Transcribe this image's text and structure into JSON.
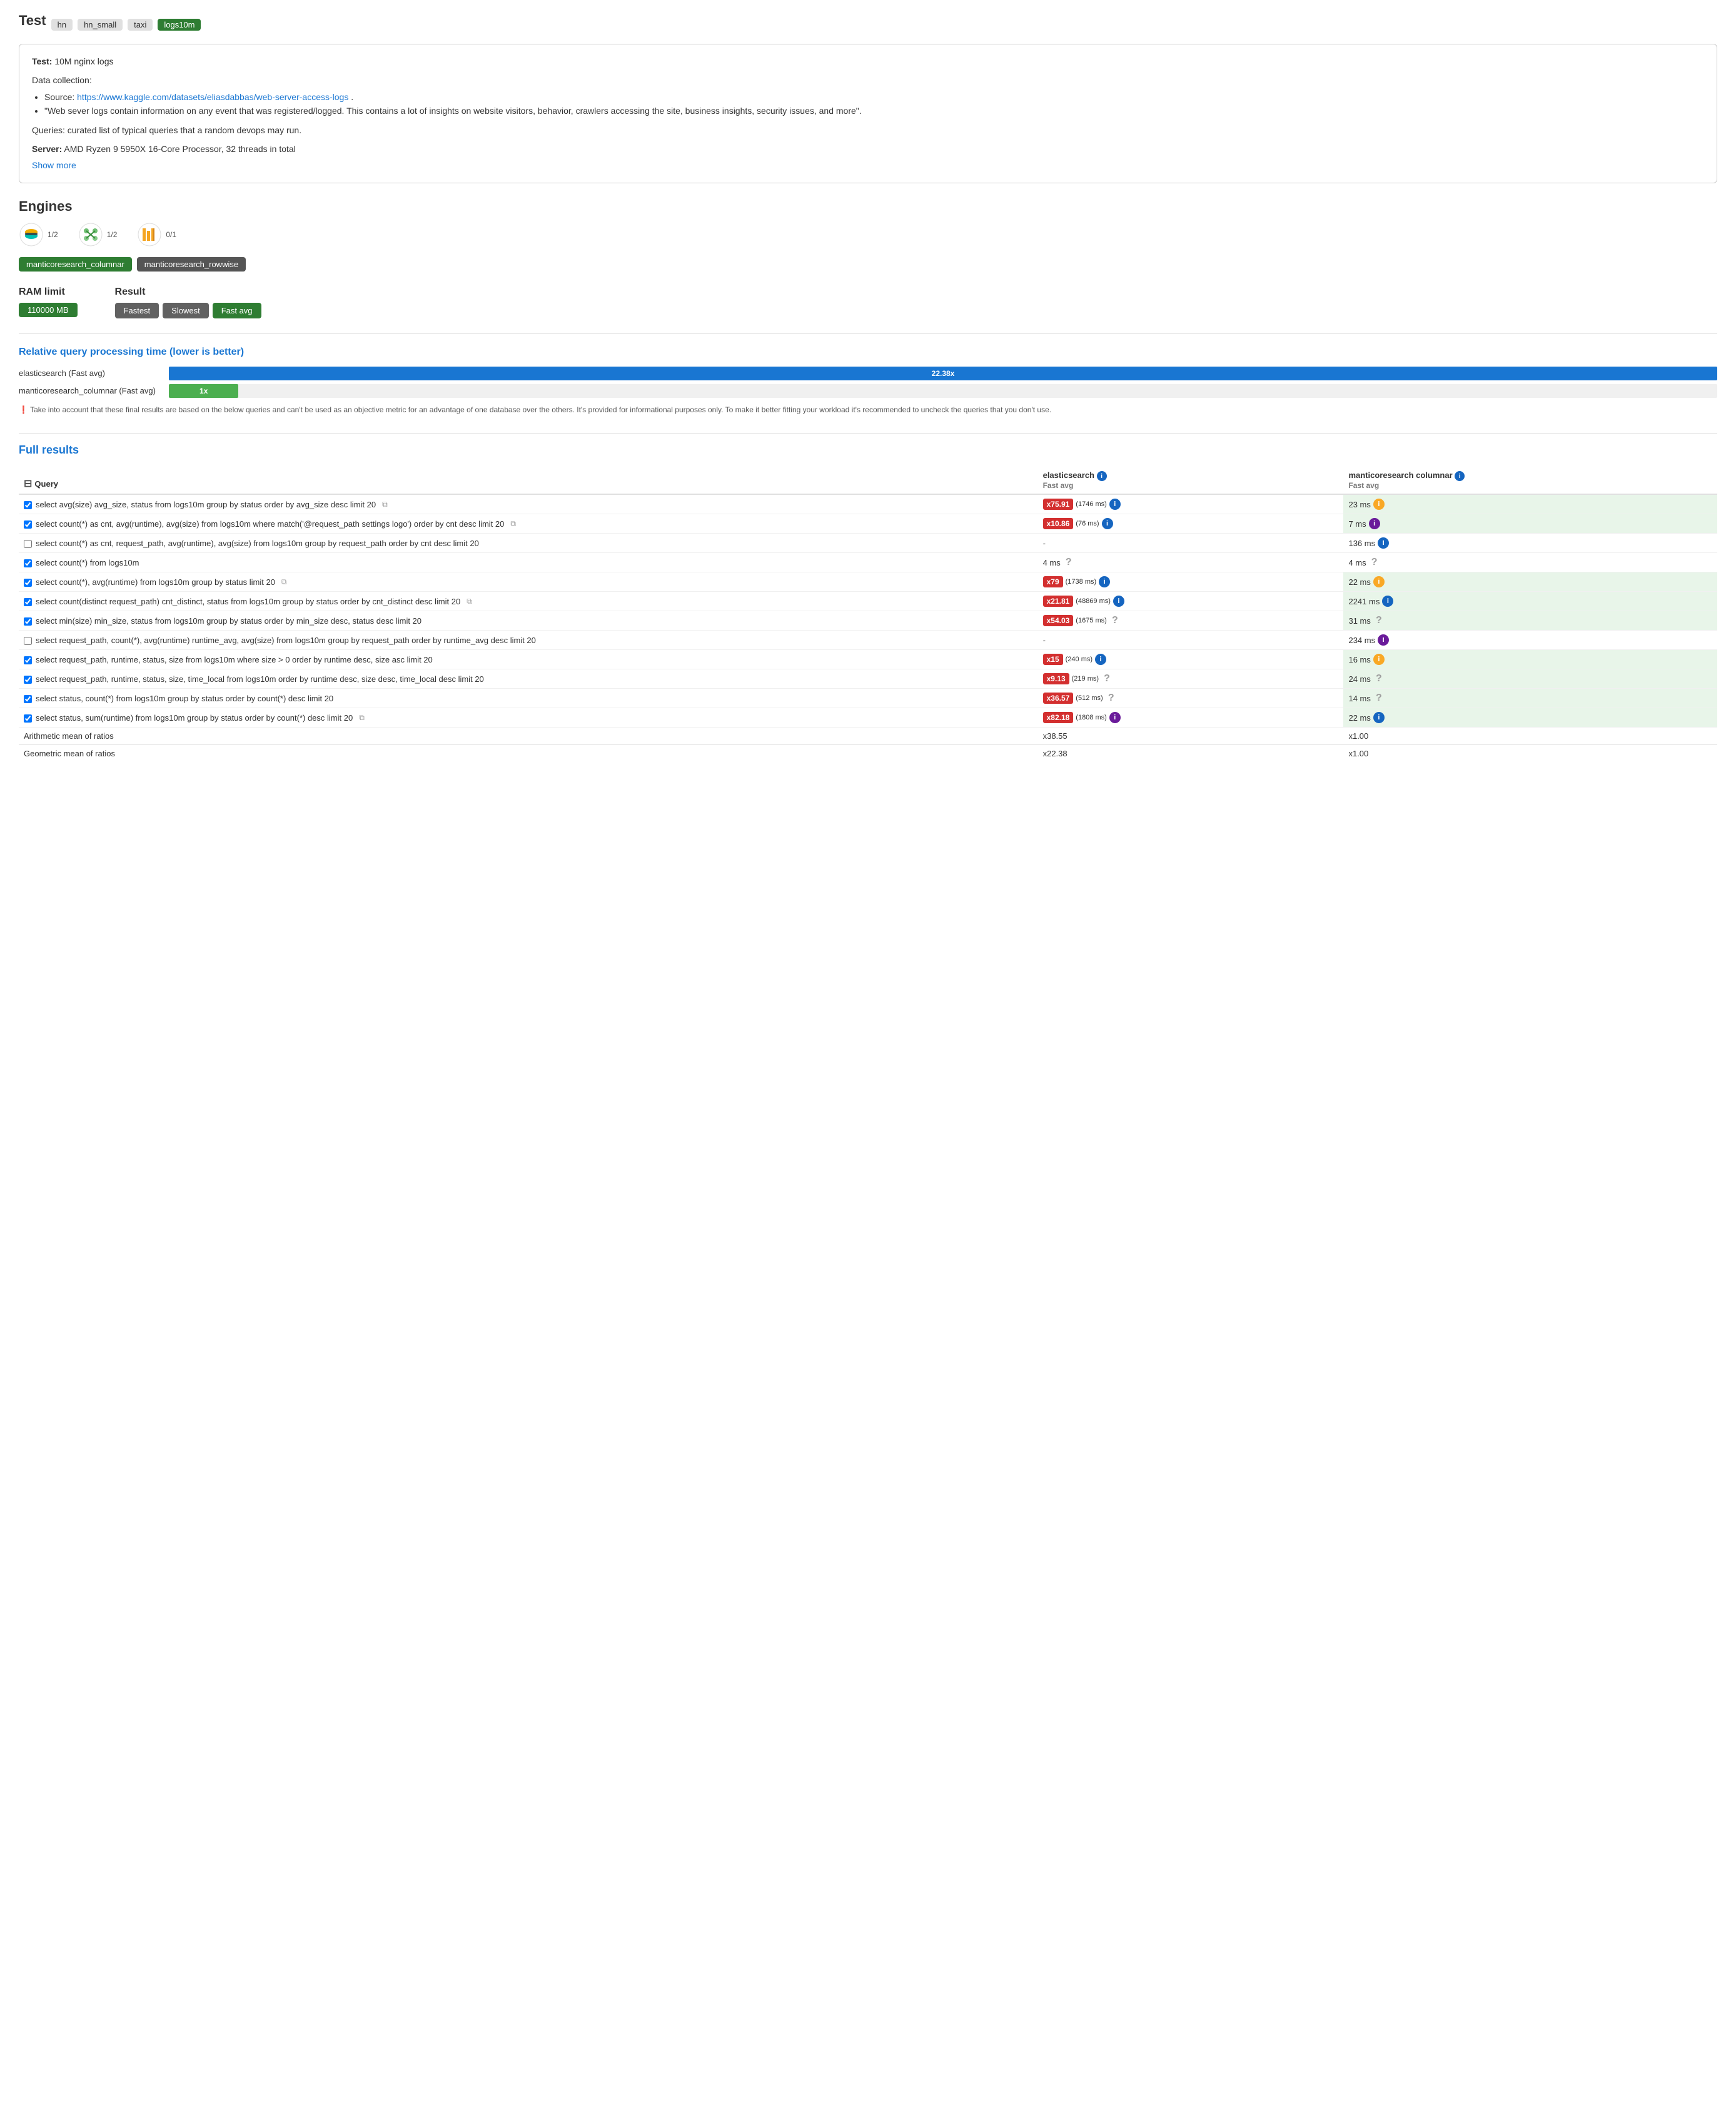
{
  "header": {
    "title": "Test",
    "tags": [
      {
        "label": "hn",
        "style": "gray"
      },
      {
        "label": "hn_small",
        "style": "gray"
      },
      {
        "label": "taxi",
        "style": "gray"
      },
      {
        "label": "logs10m",
        "style": "green"
      }
    ]
  },
  "infoBox": {
    "testLabel": "Test:",
    "testValue": "10M nginx logs",
    "dataCollectionLabel": "Data collection:",
    "bullets": [
      {
        "text": "Source: ",
        "link": "https://www.kaggle.com/datasets/eliasdabbas/web-server-access-logs",
        "linkText": "https://www.kaggle.com/datasets/eliasdabbas/web-server-access-logs",
        "suffix": "."
      },
      {
        "text": "\"Web sever logs contain information on any event that was registered/logged. This contains a lot of insights on website visitors, behavior, crawlers accessing the site, business insights, security issues, and more\"."
      }
    ],
    "queries": "Queries: curated list of typical queries that a random devops may run.",
    "serverLabel": "Server:",
    "serverValue": " AMD Ryzen 9 5950X 16-Core Processor, 32 threads in total",
    "showMore": "Show more"
  },
  "engines": {
    "sectionTitle": "Engines",
    "items": [
      {
        "name": "elasticsearch",
        "badge": "1/2"
      },
      {
        "name": "manticoresearch",
        "badge": "1/2"
      },
      {
        "name": "clickhouse",
        "badge": "0/1"
      }
    ],
    "tags": [
      {
        "label": "manticoresearch_columnar",
        "selected": true
      },
      {
        "label": "manticoresearch_rowwise",
        "selected": false
      }
    ]
  },
  "config": {
    "ramLabel": "RAM limit",
    "ramValue": "110000 MB",
    "resultLabel": "Result",
    "resultBtns": [
      {
        "label": "Fastest",
        "style": "gray"
      },
      {
        "label": "Slowest",
        "style": "gray"
      },
      {
        "label": "Fast avg",
        "style": "green"
      }
    ]
  },
  "chart": {
    "title": "Relative query processing time (lower is better)",
    "rows": [
      {
        "label": "elasticsearch (Fast avg)",
        "value": "22.38x",
        "pct": 100,
        "style": "blue"
      },
      {
        "label": "manticoresearch_columnar (Fast avg)",
        "value": "1x",
        "pct": 4.5,
        "style": "green"
      }
    ],
    "note": "Take into account that these final results are based on the below queries and can't be used as an objective metric for an advantage of one database over the others. It's provided for informational purposes only. To make it better fitting your workload it's recommended to uncheck the queries that you don't use."
  },
  "fullResults": {
    "title": "Full results",
    "columns": {
      "query": "Query",
      "elasticsearch": {
        "engine": "elasticsearch",
        "metric": "Fast avg"
      },
      "manticore": {
        "engine": "manticoresearch columnar",
        "metric": "Fast avg"
      }
    },
    "rows": [
      {
        "checked": true,
        "query": "select avg(size) avg_size, status from logs10m group by status order by avg_size desc limit 20",
        "hasCopy": true,
        "elastic": {
          "value": "x75.91",
          "ms": "(1746 ms)",
          "style": "red",
          "icon": "info-blue"
        },
        "manticore": {
          "value": "23 ms",
          "style": "plain",
          "icon": "info-yellow"
        }
      },
      {
        "checked": true,
        "query": "select count(*) as cnt, avg(runtime), avg(size) from logs10m where match('@request_path settings logo') order by cnt desc limit 20",
        "hasCopy": true,
        "elastic": {
          "value": "x10.86",
          "ms": "(76 ms)",
          "style": "red",
          "icon": "info-blue"
        },
        "manticore": {
          "value": "7 ms",
          "style": "plain",
          "icon": "info-purple"
        }
      },
      {
        "checked": false,
        "query": "select count(*) as cnt, request_path, avg(runtime), avg(size) from logs10m group by request_path order by cnt desc limit 20",
        "hasCopy": false,
        "elastic": {
          "value": "-",
          "style": "plain",
          "icon": null
        },
        "manticore": {
          "value": "136 ms",
          "style": "plain",
          "icon": "info-blue"
        }
      },
      {
        "checked": true,
        "query": "select count(*) from logs10m",
        "hasCopy": false,
        "elastic": {
          "value": "4 ms",
          "style": "plain",
          "icon": "question"
        },
        "manticore": {
          "value": "4 ms",
          "style": "plain",
          "icon": "question"
        }
      },
      {
        "checked": true,
        "query": "select count(*), avg(runtime) from logs10m group by status limit 20",
        "hasCopy": true,
        "elastic": {
          "value": "x79",
          "ms": "(1738 ms)",
          "style": "red",
          "icon": "info-blue"
        },
        "manticore": {
          "value": "22 ms",
          "style": "plain",
          "icon": "info-yellow"
        }
      },
      {
        "checked": true,
        "query": "select count(distinct request_path) cnt_distinct, status from logs10m group by status order by cnt_distinct desc limit 20",
        "hasCopy": true,
        "elastic": {
          "value": "x21.81",
          "ms": "(48869 ms)",
          "style": "red",
          "icon": "info-blue"
        },
        "manticore": {
          "value": "2241 ms",
          "style": "plain",
          "icon": "info-blue"
        }
      },
      {
        "checked": true,
        "query": "select min(size) min_size, status from logs10m group by status order by min_size desc, status desc limit 20",
        "hasCopy": false,
        "elastic": {
          "value": "x54.03",
          "ms": "(1675 ms)",
          "style": "red",
          "icon": "question"
        },
        "manticore": {
          "value": "31 ms",
          "style": "plain",
          "icon": "question"
        }
      },
      {
        "checked": false,
        "query": "select request_path, count(*), avg(runtime) runtime_avg, avg(size) from logs10m group by request_path order by runtime_avg desc limit 20",
        "hasCopy": false,
        "elastic": {
          "value": "-",
          "style": "plain",
          "icon": null
        },
        "manticore": {
          "value": "234 ms",
          "style": "plain",
          "icon": "info-purple"
        }
      },
      {
        "checked": true,
        "query": "select request_path, runtime, status, size from logs10m where size > 0 order by runtime desc, size asc limit 20",
        "hasCopy": false,
        "elastic": {
          "value": "x15",
          "ms": "(240 ms)",
          "style": "red",
          "icon": "info-blue"
        },
        "manticore": {
          "value": "16 ms",
          "style": "plain",
          "icon": "info-yellow"
        }
      },
      {
        "checked": true,
        "query": "select request_path, runtime, status, size, time_local from logs10m order by runtime desc, size desc, time_local desc limit 20",
        "hasCopy": false,
        "elastic": {
          "value": "x9.13",
          "ms": "(219 ms)",
          "style": "red",
          "icon": "question"
        },
        "manticore": {
          "value": "24 ms",
          "style": "plain",
          "icon": "question"
        }
      },
      {
        "checked": true,
        "query": "select status, count(*) from logs10m group by status order by count(*) desc limit 20",
        "hasCopy": false,
        "elastic": {
          "value": "x36.57",
          "ms": "(512 ms)",
          "style": "red",
          "icon": "question"
        },
        "manticore": {
          "value": "14 ms",
          "style": "plain",
          "icon": "question"
        }
      },
      {
        "checked": true,
        "query": "select status, sum(runtime) from logs10m group by status order by count(*) desc limit 20",
        "hasCopy": true,
        "elastic": {
          "value": "x82.18",
          "ms": "(1808 ms)",
          "style": "red",
          "icon": "info-purple"
        },
        "manticore": {
          "value": "22 ms",
          "style": "plain",
          "icon": "info-blue"
        }
      }
    ],
    "means": [
      {
        "label": "Arithmetic mean of ratios",
        "elastic": "x38.55",
        "manticore": "x1.00"
      },
      {
        "label": "Geometric mean of ratios",
        "elastic": "x22.38",
        "manticore": "x1.00"
      }
    ]
  }
}
